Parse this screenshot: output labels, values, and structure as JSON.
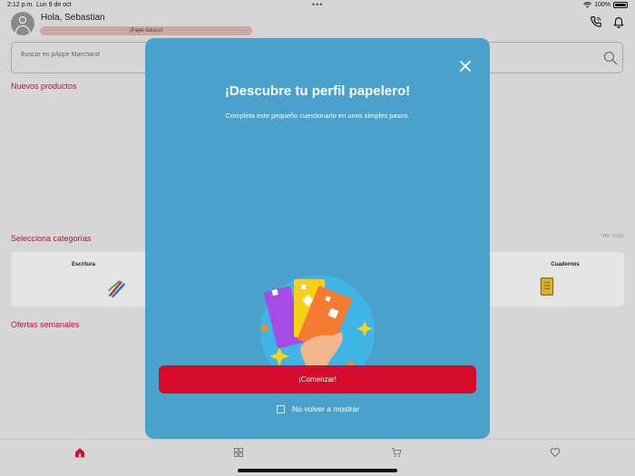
{
  "status_bar": {
    "time": "2:12 p.m.",
    "date": "Lun 9 de oct",
    "battery": "100%"
  },
  "header": {
    "greeting": "Hola, Sebastian",
    "level_badge": "¡Pape-básico!",
    "icons": [
      "phone-icon",
      "bell-icon"
    ]
  },
  "search": {
    "placeholder": "Buscar en pAppe Marchand"
  },
  "sections": {
    "new_products": "Nuevos productos",
    "categories": "Selecciona categorías",
    "see_more": "Ver más",
    "weekly_offers": "Ofertas semanales"
  },
  "categories": [
    {
      "label": "Escritura",
      "icon": "pens-icon"
    },
    {
      "label": "Cuadernos",
      "icon": "notebook-icon"
    }
  ],
  "bottom_nav": [
    {
      "icon": "home-icon",
      "active": true
    },
    {
      "icon": "grid-icon",
      "active": false
    },
    {
      "icon": "cart-icon",
      "active": false
    },
    {
      "icon": "heart-icon",
      "active": false
    }
  ],
  "modal": {
    "title": "¡Descubre tu perfil papelero!",
    "subtitle": "Completa este pequeño cuestionario en unos simples pasos.",
    "start_button": "¡Comenzar!",
    "dont_show_label": "No volver a mostrar",
    "dont_show_checked": false
  },
  "colors": {
    "modal_bg": "#4aa1cc",
    "accent_red": "#d60b2c",
    "section_title": "#b21a2e",
    "background": "#d6d6d6"
  }
}
